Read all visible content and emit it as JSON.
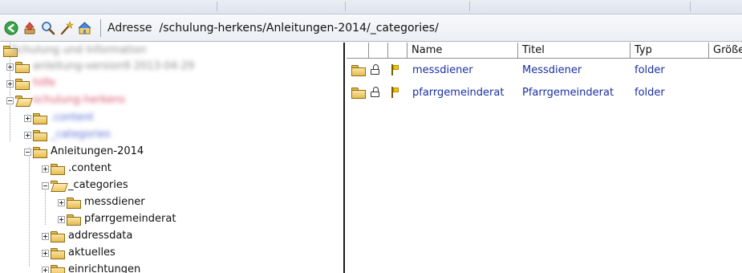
{
  "toolbar": {
    "icons": [
      "back-icon",
      "upload-icon",
      "search-icon",
      "magic-wand-icon",
      "home-up-icon"
    ],
    "address_label": "Adresse",
    "address_value": "/schulung-herkens/Anleitungen-2014/_categories/"
  },
  "tree": {
    "items": [
      {
        "label": "Schulung und Information",
        "style": "blur"
      },
      {
        "label": "anleitung-version9 2013-04-29",
        "style": "blur"
      },
      {
        "label": "hilfe",
        "style": "blur-red"
      },
      {
        "label": "schulung-herkens",
        "style": "blur-red"
      },
      {
        "label": ".content",
        "style": "blur-blue"
      },
      {
        "label": "_categories",
        "style": "blur-blue"
      },
      {
        "label": "Anleitungen-2014",
        "style": "normal"
      },
      {
        "label": ".content",
        "style": "normal"
      },
      {
        "label": "_categories",
        "style": "normal"
      },
      {
        "label": "messdiener",
        "style": "normal"
      },
      {
        "label": "pfarrgemeinderat",
        "style": "normal"
      },
      {
        "label": "addressdata",
        "style": "normal"
      },
      {
        "label": "aktuelles",
        "style": "normal"
      },
      {
        "label": "einrichtungen",
        "style": "normal"
      }
    ]
  },
  "list": {
    "columns": [
      "Name",
      "Titel",
      "Typ",
      "Größe"
    ],
    "rows": [
      {
        "name": "messdiener",
        "title": "Messdiener",
        "type": "folder"
      },
      {
        "name": "pfarrgemeinderat",
        "title": "Pfarrgemeinderat",
        "type": "folder"
      }
    ]
  },
  "colors": {
    "link_blue": "#1a2fa0",
    "folder_yellow": "#e5bd52"
  }
}
